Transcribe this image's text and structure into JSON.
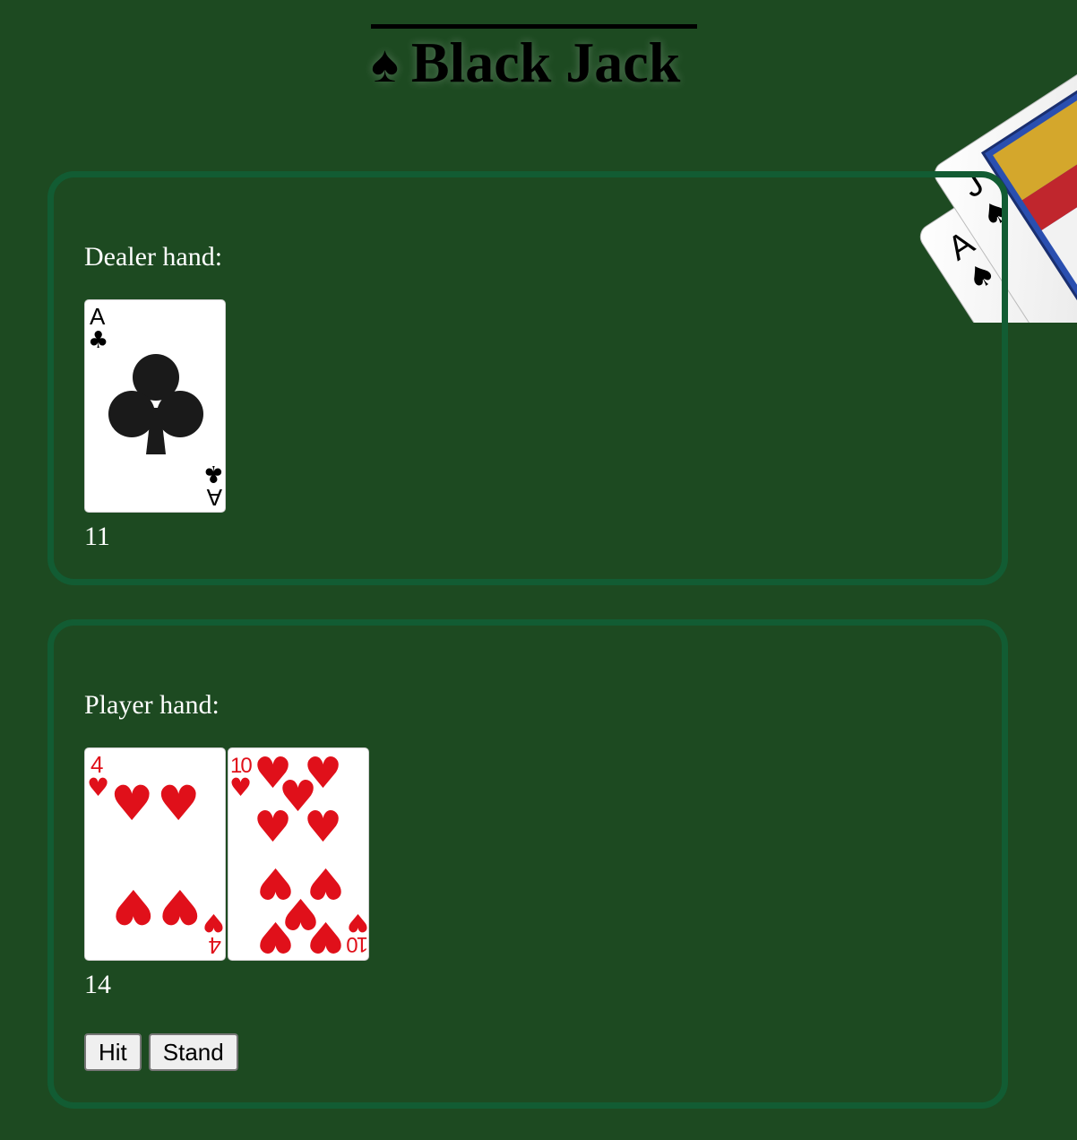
{
  "title": {
    "icon": "spade-icon",
    "text": "Black Jack"
  },
  "dealer": {
    "label": "Dealer hand:",
    "score": "11",
    "cards": [
      {
        "rank": "A",
        "suit": "clubs",
        "suit_symbol": "♣",
        "color": "#000000"
      }
    ]
  },
  "player": {
    "label": "Player hand:",
    "score": "14",
    "cards": [
      {
        "rank": "4",
        "suit": "hearts",
        "suit_symbol": "♥",
        "color": "#e0101a"
      },
      {
        "rank": "10",
        "suit": "hearts",
        "suit_symbol": "♥",
        "color": "#e0101a"
      }
    ]
  },
  "controls": {
    "hit_label": "Hit",
    "stand_label": "Stand"
  },
  "decoration": {
    "cards": [
      {
        "rank": "J",
        "suit": "spades"
      },
      {
        "rank": "A",
        "suit": "spades"
      }
    ]
  },
  "colors": {
    "table_background": "#1d4a21",
    "panel_border": "#125c33",
    "hearts": "#e0101a",
    "clubs": "#000000"
  }
}
